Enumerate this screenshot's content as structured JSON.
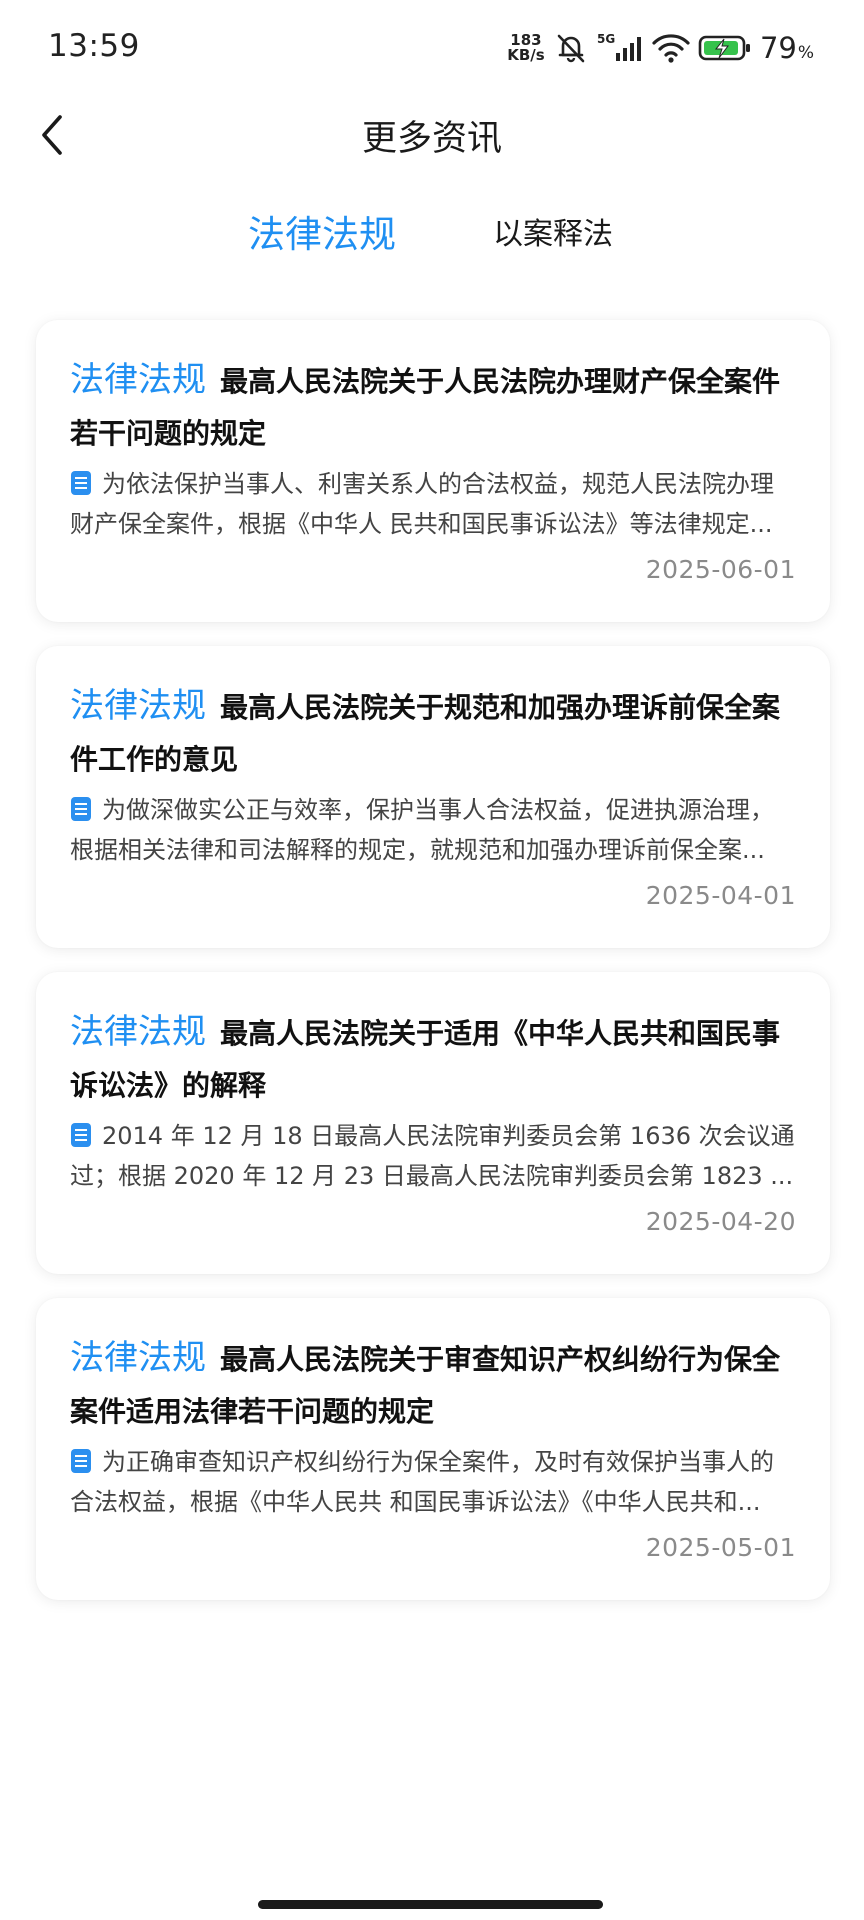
{
  "status_bar": {
    "time": "13:59",
    "net_speed_value": "183",
    "net_speed_unit": "KB/s",
    "network": "5G",
    "battery_percent": "79",
    "battery_unit": "%"
  },
  "header": {
    "title": "更多资讯",
    "back_icon": "chevron-left-icon"
  },
  "tabs": [
    {
      "label": "法律法规",
      "active": true
    },
    {
      "label": "以案释法",
      "active": false
    }
  ],
  "articles": [
    {
      "tag": "法律法规",
      "title": "最高人民法院关于人民法院办理财产保全案件若干问题的规定",
      "summary_line1": "为依法保护当事人、利害关系人的合法权益，规范人民法院办理",
      "summary_line2": "财产保全案件，根据《中华人 民共和国民事诉讼法》等法律规定...",
      "date": "2025-06-01"
    },
    {
      "tag": "法律法规",
      "title": "最高人民法院关于规范和加强办理诉前保全案件工作的意见",
      "summary_line1": "为做深做实公正与效率，保护当事人合法权益，促进执源治理，",
      "summary_line2": "根据相关法律和司法解释的规定，就规范和加强办理诉前保全案...",
      "date": "2025-04-01"
    },
    {
      "tag": "法律法规",
      "title": "最高人民法院关于适用《中华人民共和国民事诉讼法》的解释",
      "summary_line1": "2014 年 12 月 18 日最高人民法院审判委员会第 1636 次会议通",
      "summary_line2": "过；根据 2020 年 12 月 23 日最高人民法院审判委员会第 1823 ...",
      "date": "2025-04-20"
    },
    {
      "tag": "法律法规",
      "title": "最高人民法院关于审查知识产权纠纷行为保全案件适用法律若干问题的规定",
      "summary_line1": "为正确审查知识产权纠纷行为保全案件，及时有效保护当事人的",
      "summary_line2": "合法权益，根据《中华人民共 和国民事诉讼法》《中华人民共和...",
      "date": "2025-05-01"
    }
  ],
  "colors": {
    "accent": "#1f8ff2",
    "text_primary": "#111111",
    "text_secondary": "#444444",
    "date": "#8a8a8a"
  }
}
